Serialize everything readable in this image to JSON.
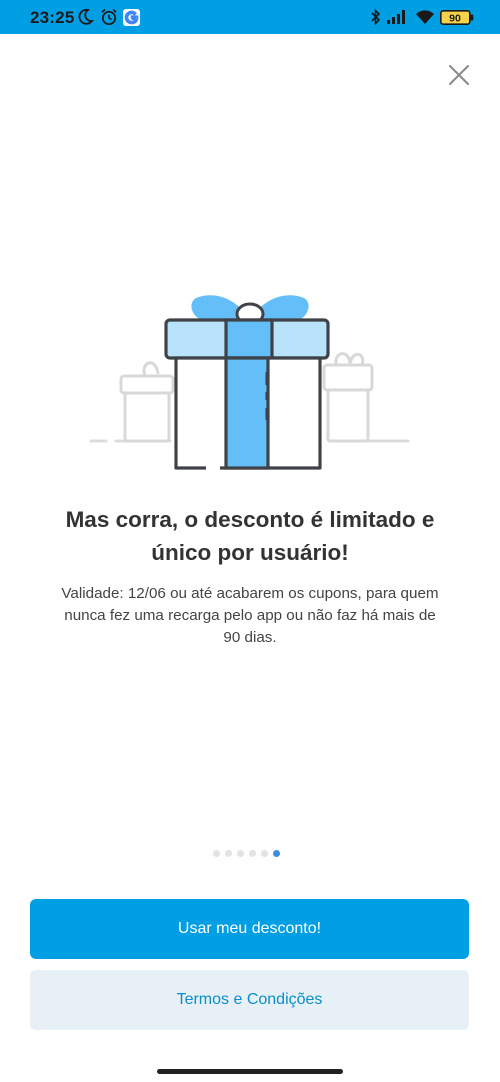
{
  "status_bar": {
    "time": "23:25",
    "battery": "90",
    "icons": [
      "moon-icon",
      "alarm-icon",
      "google-icon",
      "bluetooth-icon",
      "signal-icon",
      "wifi-icon",
      "battery-icon"
    ]
  },
  "close": {
    "icon": "close-icon"
  },
  "illustration": {
    "icon": "gift-icon"
  },
  "content": {
    "headline_line1": "Mas corra, o desconto é limitado e",
    "headline_line2": "único por usuário!",
    "description_line1": "Validade: 12/06 ou até acabarem os cupons, para quem",
    "description_line2": "nunca fez uma recarga pelo app ou não faz há mais de",
    "description_line3": "90 dias."
  },
  "pagination": {
    "total": 6,
    "current": 6
  },
  "buttons": {
    "primary_label": "Usar meu desconto!",
    "secondary_label": "Termos e Condições"
  },
  "colors": {
    "brand": "#009ee3",
    "secondary_bg": "#e7f0f6",
    "secondary_text": "#0a8fc8",
    "ribbon": "#64bff8",
    "ribbon_light": "#b9e3fb",
    "active_dot": "#3a8ee6"
  }
}
